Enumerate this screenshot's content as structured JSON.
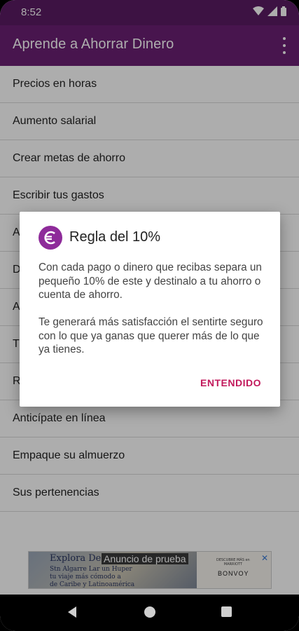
{
  "status_bar": {
    "time": "8:52"
  },
  "app_bar": {
    "title": "Aprende a Ahorrar Dinero",
    "more_icon": "more-vert-icon"
  },
  "list": {
    "items": [
      {
        "label": "Precios en horas"
      },
      {
        "label": "Aumento salarial"
      },
      {
        "label": "Crear metas de ahorro"
      },
      {
        "label": "Escribir tus gastos"
      },
      {
        "label": "A"
      },
      {
        "label": "D"
      },
      {
        "label": "A"
      },
      {
        "label": "T"
      },
      {
        "label": "R"
      },
      {
        "label": "Anticípate en línea"
      },
      {
        "label": "Empaque su almuerzo"
      },
      {
        "label": "Sus pertenencias"
      }
    ]
  },
  "dialog": {
    "icon": "euro-icon",
    "title": "Regla del 10%",
    "paragraphs": [
      "Con cada pago o dinero que recibas separa un pequeño 10% de este y destinalo a tu ahorro o cuenta de ahorro.",
      "Te generará más satisfacción el sentirte seguro con lo que ya ganas que querer más de lo que ya tienes."
    ],
    "action_label": "ENTENDIDO"
  },
  "ad": {
    "label": "Anuncio de prueba",
    "left_brand": "Explora Des",
    "left_sub": "Stn Algarre Lar un Huper\ntu viaje más cómodo a\nde Caribe y Latinoamérica",
    "right_top": "DESCUBRE MÁS en\nMARRIOTT",
    "right_brand": "BONVOY"
  },
  "colors": {
    "primary": "#6a1f74",
    "status": "#5a1b63",
    "accent": "#c2185b",
    "icon_bg": "#8e2b9a"
  }
}
